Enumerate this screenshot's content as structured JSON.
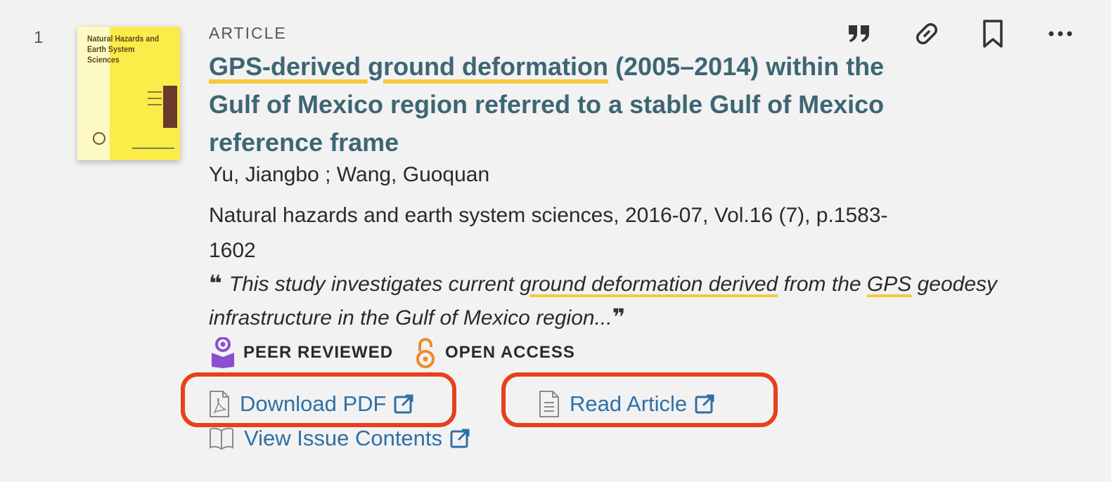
{
  "result": {
    "index": "1",
    "type": "ARTICLE",
    "thumbnail": {
      "journal_title": "Natural Hazards and Earth System Sciences"
    },
    "title": {
      "highlighted": "GPS-derived ground deformation",
      "rest": " (2005–2014) within the Gulf of Mexico region referred to a stable Gulf of Mexico reference frame"
    },
    "authors": "Yu, Jiangbo ; Wang, Guoquan",
    "source": "Natural hazards and earth system sciences, 2016-07, Vol.16 (7), p.1583-1602",
    "snippet": {
      "open_quote": "❝",
      "part1": "This study investigates current ",
      "hl1": "ground deformation derived",
      "part2": " from the ",
      "hl2": "GPS",
      "part3": " geodesy infrastructure in the Gulf of Mexico region...",
      "close_quote": "❞"
    },
    "badges": {
      "peer_reviewed": "PEER REVIEWED",
      "open_access": "OPEN ACCESS"
    },
    "links": {
      "download_pdf": "Download PDF",
      "read_article": "Read Article",
      "view_issue": "View Issue Contents"
    },
    "actions": [
      "citation-icon",
      "permalink-icon",
      "bookmark-icon",
      "more-options-icon"
    ]
  },
  "colors": {
    "background": "#f2f2f2",
    "title": "#3d6674",
    "highlight": "#f5c93a",
    "link": "#2f6fa7",
    "callout": "#e8401c",
    "peer_reviewed_icon": "#8a4fd1",
    "open_access_icon": "#f08a24"
  }
}
